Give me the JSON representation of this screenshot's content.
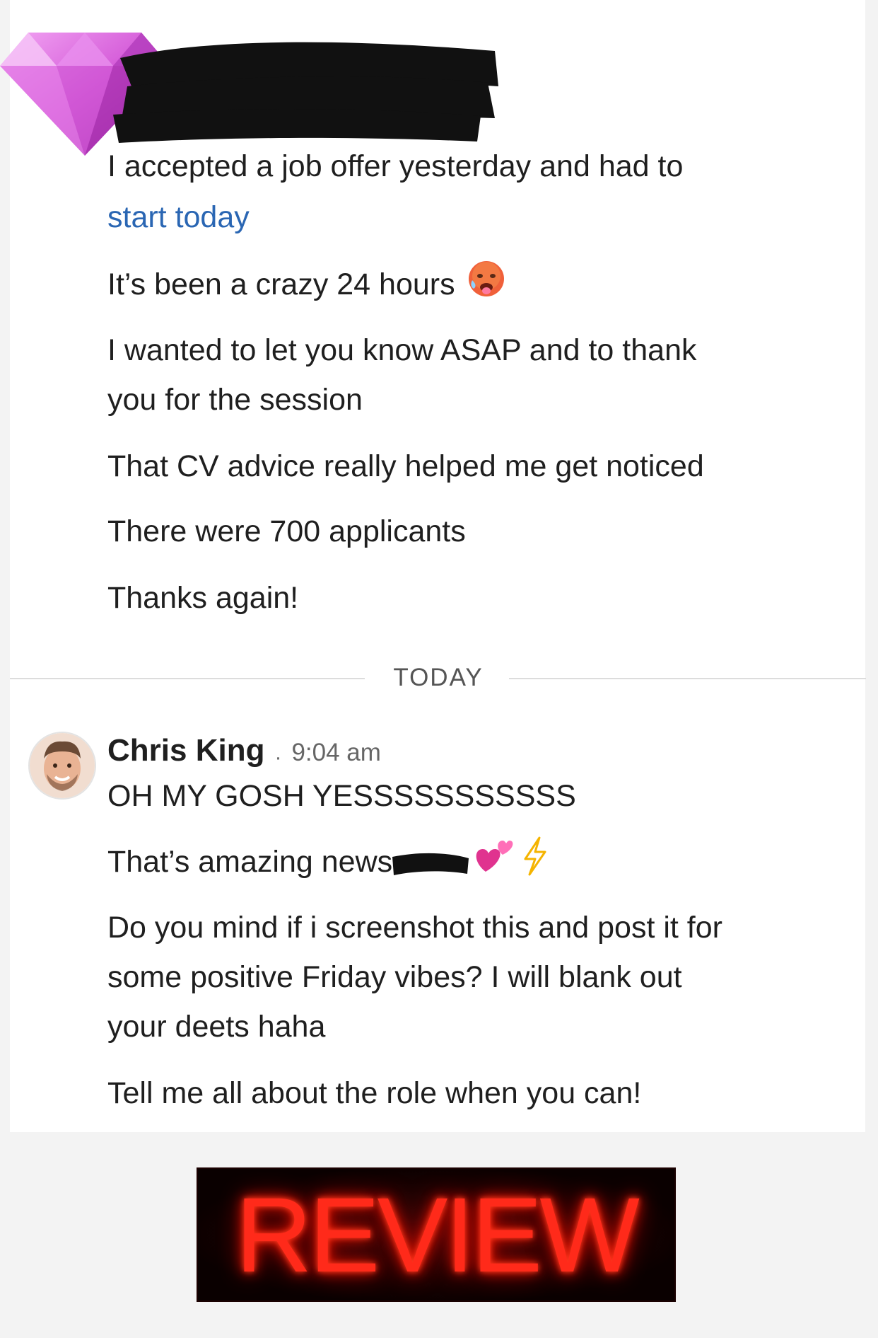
{
  "first_sender": {
    "avatar_icon": "pink-diamond-icon",
    "name_redacted": true
  },
  "first_messages": {
    "line1": "I accepted a job offer yesterday and had to",
    "line2_link": "start today",
    "line3": "It’s been a crazy 24 hours",
    "line3_emoji": "hot-face-emoji",
    "line4": "I wanted to let you know ASAP and to thank",
    "line5": "you for the session",
    "line6": "That CV advice really helped me get noticed",
    "line7": "There were 700 applicants",
    "line8": "Thanks again!"
  },
  "date_separator": "TODAY",
  "second_sender": {
    "name": "Chris King",
    "separator": "·",
    "time": "9:04 am"
  },
  "second_messages": {
    "line1": "OH MY GOSH YESSSSSSSSSSS",
    "line2": "That’s amazing news",
    "line2_emojis": [
      "two-hearts-emoji",
      "lightning-emoji"
    ],
    "line3": "Do you mind if i screenshot this and post it for",
    "line4": "some positive Friday vibes? I will blank out",
    "line5": "your deets haha",
    "line6": "Tell me all about the role when you can!"
  },
  "banner": {
    "text": "REVIEW",
    "color": "#ff2a1a"
  },
  "colors": {
    "link": "#2a66b3",
    "text": "#1f1f1f",
    "muted": "#666666"
  }
}
